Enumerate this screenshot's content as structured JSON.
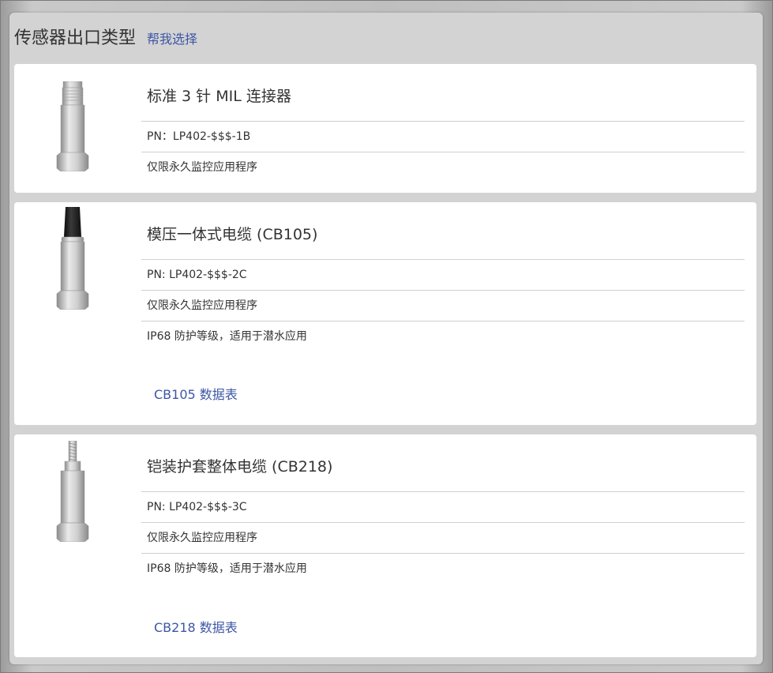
{
  "page": {
    "title": "传感器出口类型",
    "help_link": "帮我选择"
  },
  "items": [
    {
      "title": "标准 3 针 MIL 连接器",
      "specs": [
        "PN：LP402-$$$-1B",
        "仅限永久监控应用程序"
      ],
      "thumbnail_icon": "mil-connector-sensor-icon"
    },
    {
      "title": "模压一体式电缆 (CB105)",
      "specs": [
        "PN: LP402-$$$-2C",
        "仅限永久监控应用程序",
        "IP68 防护等级，适用于潜水应用"
      ],
      "datasheet_link": "CB105 数据表",
      "thumbnail_icon": "molded-cable-sensor-icon"
    },
    {
      "title": "铠装护套整体电缆 (CB218)",
      "specs": [
        "PN: LP402-$$$-3C",
        "仅限永久监控应用程序",
        "IP68 防护等级，适用于潜水应用"
      ],
      "datasheet_link": "CB218 数据表",
      "thumbnail_icon": "armored-cable-sensor-icon"
    }
  ],
  "colors": {
    "link": "#3d56a6",
    "text": "#333333",
    "panel_bg": "#d3d3d3",
    "card_bg": "#ffffff",
    "divider": "#cfcfcf"
  }
}
